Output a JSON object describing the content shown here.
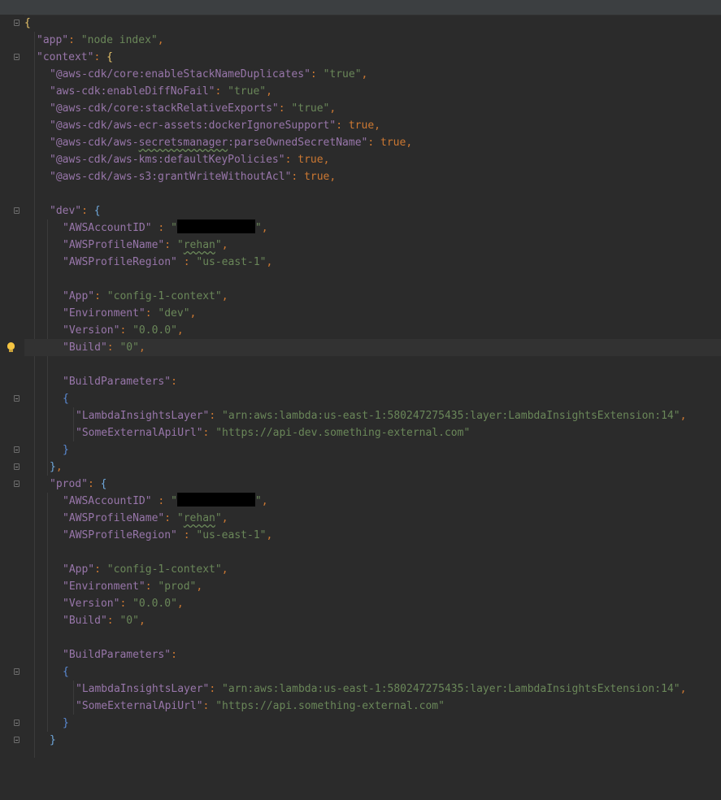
{
  "editor": {
    "language": "json",
    "file_content": {
      "app_key": "\"app\"",
      "app_val": "\"node index\"",
      "context_key": "\"context\"",
      "flags": [
        {
          "key": "\"@aws-cdk/core:enableStackNameDuplicates\"",
          "val": "\"true\""
        },
        {
          "key": "\"aws-cdk:enableDiffNoFail\"",
          "val": "\"true\""
        },
        {
          "key": "\"@aws-cdk/core:stackRelativeExports\"",
          "val": "\"true\""
        },
        {
          "key": "\"@aws-cdk/aws-ecr-assets:dockerIgnoreSupport\"",
          "val": "true"
        },
        {
          "key_a": "\"@aws-cdk/aws-",
          "key_b": "secretsmanager",
          "key_c": ":parseOwnedSecretName\"",
          "val": "true"
        },
        {
          "key": "\"@aws-cdk/aws-kms:defaultKeyPolicies\"",
          "val": "true"
        },
        {
          "key": "\"@aws-cdk/aws-s3:grantWriteWithoutAcl\"",
          "val": "true"
        }
      ],
      "envs": {
        "dev": {
          "key": "\"dev\"",
          "account_key": "\"AWSAccountID\"",
          "account_val_open": "\"",
          "account_val_close": "\"",
          "profile_key": "\"AWSProfileName\"",
          "profile_q1": "\"",
          "profile_name": "rehan",
          "profile_q2": "\"",
          "region_key": "\"AWSProfileRegion\"",
          "region_val": "\"us-east-1\"",
          "app_key": "\"App\"",
          "app_val": "\"config-1-context\"",
          "env_key": "\"Environment\"",
          "env_val": "\"dev\"",
          "version_key": "\"Version\"",
          "version_val": "\"0.0.0\"",
          "build_key": "\"Build\"",
          "build_val": "\"0\"",
          "bp_key": "\"BuildParameters\"",
          "layer_key": "\"LambdaInsightsLayer\"",
          "layer_val": "\"arn:aws:lambda:us-east-1:580247275435:layer:LambdaInsightsExtension:14\"",
          "api_key": "\"SomeExternalApiUrl\"",
          "api_val": "\"https://api-dev.something-external.com\""
        },
        "prod": {
          "key": "\"prod\"",
          "account_key": "\"AWSAccountID\"",
          "account_val_open": "\"",
          "account_val_close": "\"",
          "profile_key": "\"AWSProfileName\"",
          "profile_q1": "\"",
          "profile_name": "rehan",
          "profile_q2": "\"",
          "region_key": "\"AWSProfileRegion\"",
          "region_val": "\"us-east-1\"",
          "app_key": "\"App\"",
          "app_val": "\"config-1-context\"",
          "env_key": "\"Environment\"",
          "env_val": "\"prod\"",
          "version_key": "\"Version\"",
          "version_val": "\"0.0.0\"",
          "build_key": "\"Build\"",
          "build_val": "\"0\"",
          "bp_key": "\"BuildParameters\"",
          "layer_key": "\"LambdaInsightsLayer\"",
          "layer_val": "\"arn:aws:lambda:us-east-1:580247275435:layer:LambdaInsightsExtension:14\"",
          "api_key": "\"SomeExternalApiUrl\"",
          "api_val": "\"https://api.something-external.com\""
        }
      }
    },
    "colors": {
      "background": "#2b2b2b",
      "key": "#9876aa",
      "string": "#6a8759",
      "keyword": "#cc7832",
      "current_line": "#323232"
    },
    "icons": [
      "fold-icon",
      "lightbulb-icon"
    ]
  }
}
